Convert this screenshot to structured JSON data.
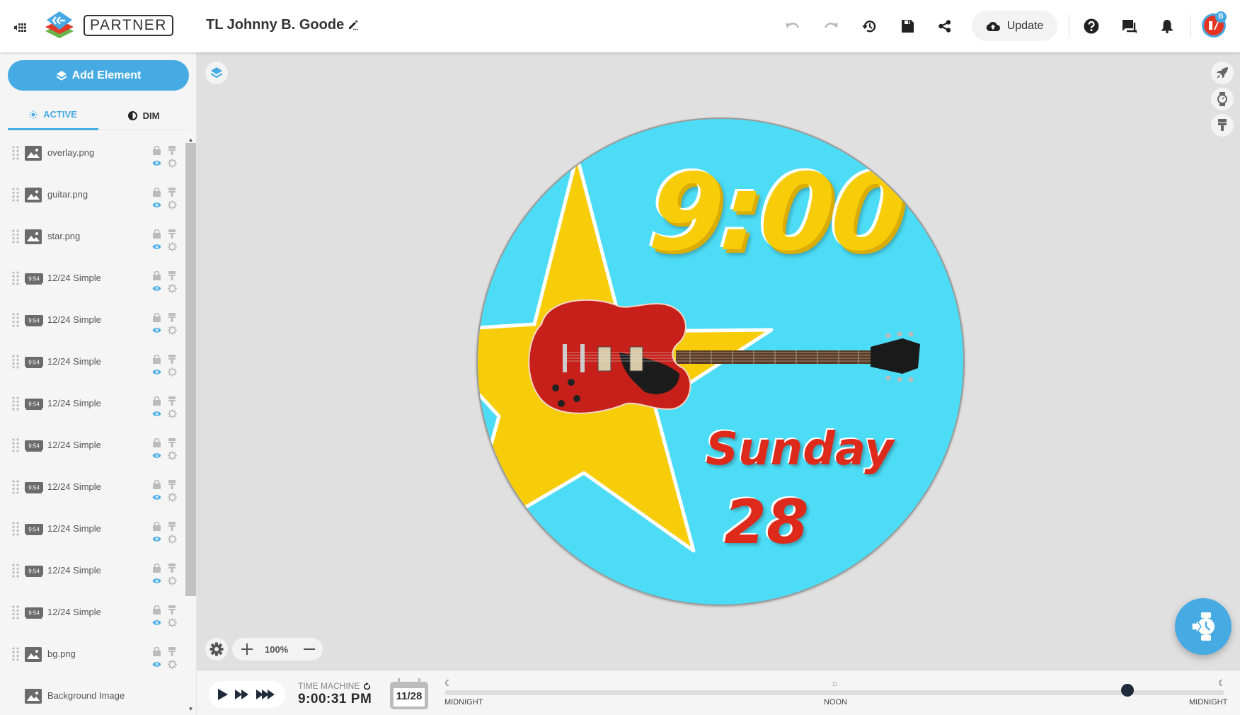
{
  "header": {
    "brand_label": "PARTNER",
    "document_title": "TL Johnny B. Goode",
    "update_label": "Update",
    "avatar_badge": "B",
    "icons": [
      "apps-icon",
      "pencil-icon",
      "undo-icon",
      "redo-icon",
      "history-icon",
      "save-icon",
      "share-icon",
      "cloud-upload-icon",
      "help-icon",
      "chat-icon",
      "bell-icon"
    ]
  },
  "sidebar": {
    "add_element_label": "Add Element",
    "tabs": [
      {
        "label": "ACTIVE",
        "active": true
      },
      {
        "label": "DIM",
        "active": false
      }
    ],
    "layers": [
      {
        "label": "overlay.png",
        "type": "image"
      },
      {
        "label": "guitar.png",
        "type": "image"
      },
      {
        "label": "star.png",
        "type": "image"
      },
      {
        "label": "12/24 Simple",
        "type": "clock"
      },
      {
        "label": "12/24 Simple",
        "type": "clock"
      },
      {
        "label": "12/24 Simple",
        "type": "clock"
      },
      {
        "label": "12/24 Simple",
        "type": "clock"
      },
      {
        "label": "12/24 Simple",
        "type": "clock"
      },
      {
        "label": "12/24 Simple",
        "type": "clock"
      },
      {
        "label": "12/24 Simple",
        "type": "clock"
      },
      {
        "label": "12/24 Simple",
        "type": "clock"
      },
      {
        "label": "12/24 Simple",
        "type": "clock"
      },
      {
        "label": "bg.png",
        "type": "image"
      },
      {
        "label": "Background Image",
        "type": "background"
      }
    ],
    "clock_thumb_text": "9:54"
  },
  "canvas": {
    "zoom_level": "100%",
    "watch_face": {
      "time": "9:00",
      "day": "Sunday",
      "date": "28"
    }
  },
  "timeline": {
    "label": "TIME MACHINE",
    "current_time": "9:00:31 PM",
    "date": "11/28",
    "markers": [
      "MIDNIGHT",
      "NOON",
      "MIDNIGHT"
    ],
    "position_fraction": 0.8756
  },
  "colors": {
    "accent": "#47abe3",
    "face_bg": "#4ddcf5",
    "star": "#f7cd0a",
    "red": "#de2a1b"
  }
}
